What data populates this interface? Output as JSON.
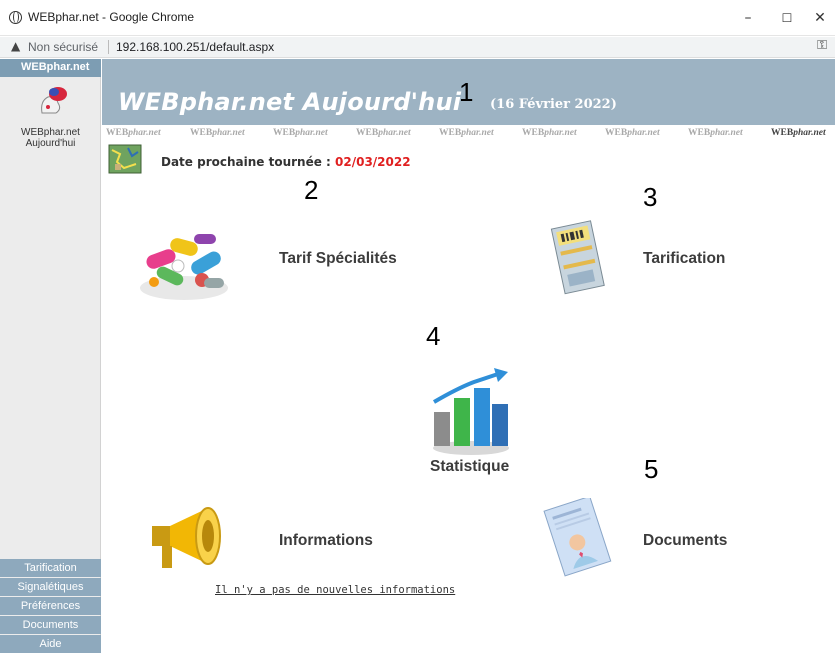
{
  "browser": {
    "window_title": "WEBphar.net - Google Chrome",
    "security_label": "Non sécurisé",
    "url": "192.168.100.251/default.aspx",
    "controls": {
      "minimize": "–",
      "maximize": "☐",
      "close": "✕"
    }
  },
  "sidebar": {
    "brand": "WEBphar.net",
    "home_label_line1": "WEBphar.net",
    "home_label_line2": "Aujourd'hui",
    "nav": [
      "Tarification",
      "Signalétiques",
      "Préférences",
      "Documents",
      "Aide"
    ]
  },
  "banner": {
    "title": "WEBphar.net Aujourd'hui",
    "date": "(16 Février 2022)"
  },
  "watermark": {
    "prefix": "WEB",
    "suffix": "phar.net"
  },
  "tournee": {
    "label": "Date prochaine tournée : ",
    "value": "02/03/2022"
  },
  "tiles": {
    "tarif_specialites": "Tarif Spécialités",
    "tarification": "Tarification",
    "statistique": "Statistique",
    "informations": "Informations",
    "documents": "Documents"
  },
  "informations_link": "Il n'y a pas de nouvelles informations",
  "annotations": [
    "1",
    "2",
    "3",
    "4",
    "5"
  ],
  "colors": {
    "banner_bg": "#9db3c3",
    "sidebar_nav_bg": "#8ea9bd",
    "date_value": "#e02020"
  }
}
